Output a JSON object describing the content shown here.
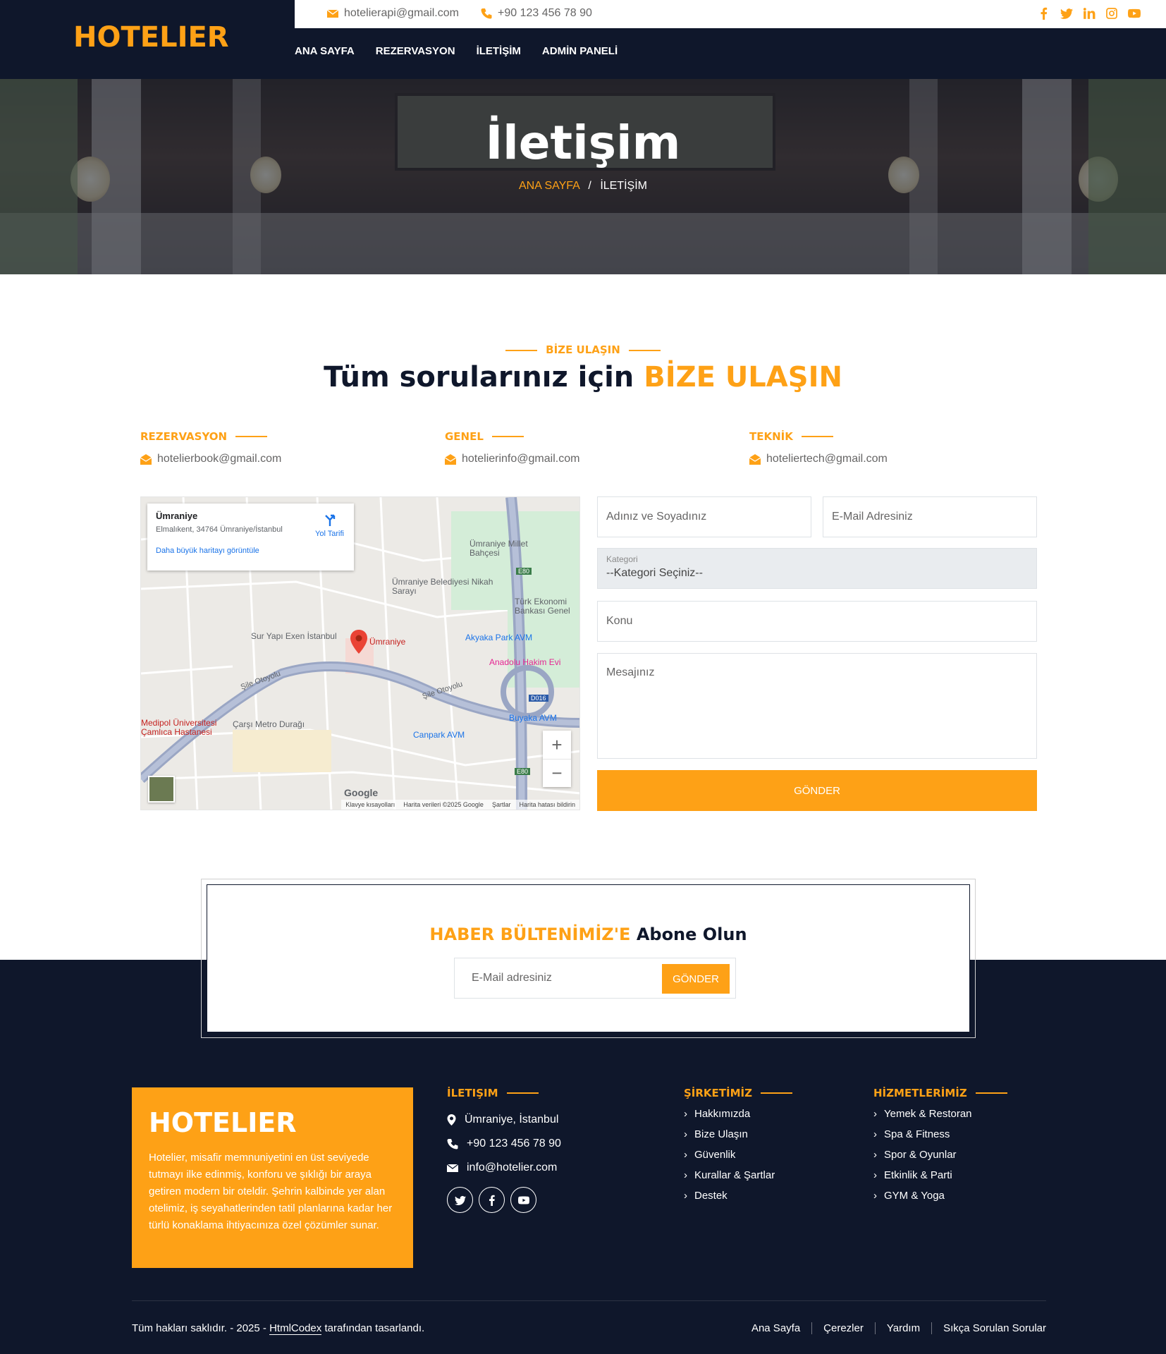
{
  "brand": {
    "name": "HOTELIER",
    "accent": "#FEA116",
    "dark": "#0F172B"
  },
  "topbar": {
    "email": "hotelierapi@gmail.com",
    "phone": "+90 123 456 78 90",
    "social_icons": [
      "facebook-icon",
      "twitter-icon",
      "linkedin-icon",
      "instagram-icon",
      "youtube-icon"
    ]
  },
  "nav": {
    "items": [
      "ANA SAYFA",
      "REZERVASYON",
      "İLETİŞİM",
      "ADMİN PANELİ"
    ]
  },
  "hero": {
    "title": "İletişim",
    "crumb_home": "ANA SAYFA",
    "crumb_sep": "/",
    "crumb_current": "İLETİŞİM"
  },
  "section": {
    "subtitle": "BİZE ULAŞIN",
    "title_plain": "Tüm sorularınız için",
    "title_accent": "BİZE ULAŞIN"
  },
  "contacts": [
    {
      "label": "REZERVASYON",
      "email": "hotelierbook@gmail.com"
    },
    {
      "label": "GENEL",
      "email": "hotelierinfo@gmail.com"
    },
    {
      "label": "TEKNİK",
      "email": "hoteliertech@gmail.com"
    }
  ],
  "map": {
    "place": "Ümraniye",
    "address": "Elmalıkent, 34764 Ümraniye/İstanbul",
    "directions": "Yol Tarifi",
    "bigger": "Daha büyük haritayı görüntüle",
    "labels": {
      "millet": "Ümraniye Millet Bahçesi",
      "belediye": "Ümraniye Belediyesi Nikah Sarayı",
      "ekonomi": "Türk Ekonomi Bankası Genel",
      "exen": "Sur Yapı Exen İstanbul",
      "pin": "Ümraniye",
      "akyaka": "Akyaka Park AVM",
      "hakim": "Anadolu Hakim Evi",
      "buyaka": "Buyaka AVM",
      "medipol": "Medipol Üniversitesi Çamlıca Hastanesi",
      "carsi": "Çarşı Metro Durağı",
      "canpark": "Canpark AVM",
      "sile1": "Şile Otoyolu",
      "sile2": "Şile Otoyolu",
      "e80a": "E80",
      "e80b": "E80",
      "d016": "D016",
      "footer_keys": "Klavye kısayolları",
      "footer_data": "Harita verileri ©2025 Google",
      "footer_terms": "Şartlar",
      "footer_report": "Harita hatası bildirin",
      "google": "Google",
      "zoom_in": "+",
      "zoom_out": "−"
    }
  },
  "form": {
    "name_placeholder": "Adınız ve Soyadınız",
    "email_placeholder": "E-Mail Adresiniz",
    "category_label": "Kategori",
    "category_value": "--Kategori Seçiniz--",
    "subject_placeholder": "Konu",
    "message_placeholder": "Mesajınız",
    "submit": "GÖNDER"
  },
  "newsletter": {
    "title_accent": "HABER BÜLTENİMİZ'E",
    "title_plain": "Abone Olun",
    "placeholder": "E-Mail adresiniz",
    "button": "GÖNDER"
  },
  "footer": {
    "about_title": "HOTELIER",
    "about_text": "Hotelier, misafir memnuniyetini en üst seviyede tutmayı ilke edinmiş, konforu ve şıklığı bir araya getiren modern bir oteldir. Şehrin kalbinde yer alan otelimiz, iş seyahatlerinden tatil planlarına kadar her türlü konaklama ihtiyacınıza özel çözümler sunar.",
    "contact_title": "İletişim",
    "address": "Ümraniye, İstanbul",
    "phone": "+90 123 456 78 90",
    "email": "info@hotelier.com",
    "company_title": "ŞİRKETİMİZ",
    "company_links": [
      "Hakkımızda",
      "Bize Ulaşın",
      "Güvenlik",
      "Kurallar & Şartlar",
      "Destek"
    ],
    "services_title": "HİZMETLERİMİZ",
    "services_links": [
      "Yemek & Restoran",
      "Spa & Fitness",
      "Spor & Oyunlar",
      "Etkinlik & Parti",
      "GYM & Yoga"
    ],
    "copyright_pre": "Tüm hakları saklıdır. - 2025 -",
    "copyright_link": "HtmlCodex",
    "copyright_post": "tarafından tasarlandı.",
    "bottom_links": [
      "Ana Sayfa",
      "Çerezler",
      "Yardım",
      "Sıkça Sorulan Sorular"
    ]
  }
}
